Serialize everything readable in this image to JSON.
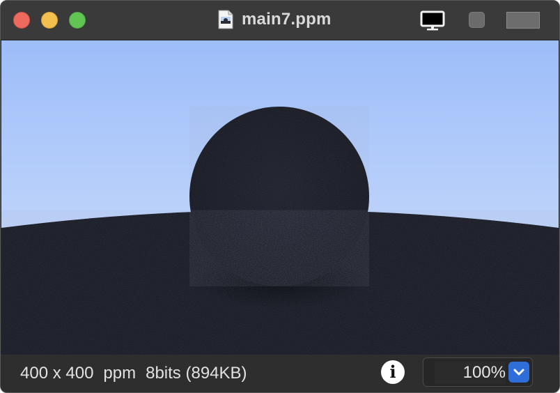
{
  "window": {
    "title": "main7.ppm"
  },
  "icons": {
    "file": "ppm-document-icon",
    "display": "display-icon",
    "info": "info-icon",
    "dropdown": "chevron-down-icon"
  },
  "status": {
    "dimensions": "400 x 400",
    "format": "ppm",
    "details": "8bits (894KB)",
    "info_glyph": "i"
  },
  "zoom": {
    "value": "100%"
  },
  "colors": {
    "sky_top": "#9dbdf9",
    "sky_bottom": "#d0dffb",
    "ground": "#14161f",
    "sphere": "#15171f",
    "zoom_accent": "#2f6ed8"
  }
}
